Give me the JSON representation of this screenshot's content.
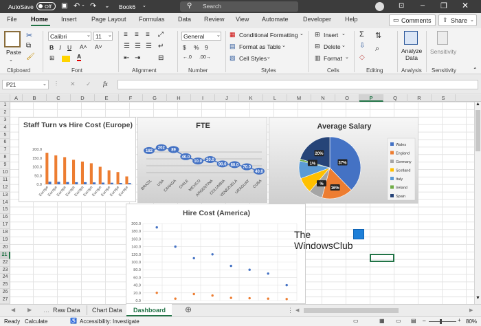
{
  "titlebar": {
    "autosave_label": "AutoSave",
    "autosave_state": "Off",
    "book_name": "Book6",
    "search_placeholder": "Search"
  },
  "tabs": [
    "File",
    "Home",
    "Insert",
    "Page Layout",
    "Formulas",
    "Data",
    "Review",
    "View",
    "Automate",
    "Developer",
    "Help"
  ],
  "active_tab": "Home",
  "comments_label": "Comments",
  "share_label": "Share",
  "ribbon": {
    "clipboard": {
      "paste": "Paste",
      "group": "Clipboard"
    },
    "font": {
      "name": "Calibri",
      "size": "11",
      "group": "Font"
    },
    "alignment": {
      "group": "Alignment"
    },
    "number": {
      "format": "General",
      "group": "Number"
    },
    "styles": {
      "conditional": "Conditional Formatting",
      "table": "Format as Table",
      "cell_styles": "Cell Styles",
      "group": "Styles"
    },
    "cells": {
      "insert": "Insert",
      "delete": "Delete",
      "format": "Format",
      "group": "Cells"
    },
    "editing": {
      "group": "Editing"
    },
    "analysis": {
      "analyze": "Analyze Data",
      "group": "Analysis"
    },
    "sensitivity": {
      "label": "Sensitivity",
      "group": "Sensitivity"
    }
  },
  "formula_bar": {
    "name_box": "P21",
    "fx": "fx",
    "value": ""
  },
  "columns": [
    "A",
    "B",
    "C",
    "D",
    "E",
    "F",
    "G",
    "H",
    "I",
    "J",
    "K",
    "L",
    "M",
    "N",
    "O",
    "P",
    "Q",
    "R",
    "S"
  ],
  "active_column": "P",
  "rows": [
    "1",
    "2",
    "3",
    "4",
    "5",
    "6",
    "7",
    "8",
    "9",
    "10",
    "11",
    "12",
    "13",
    "14",
    "15",
    "16",
    "17",
    "18",
    "19",
    "20",
    "21",
    "22",
    "23",
    "24",
    "25",
    "26",
    "27"
  ],
  "active_row": "21",
  "sheets": [
    "Raw Data",
    "Chart Data",
    "Dashboard"
  ],
  "active_sheet": "Dashboard",
  "status": {
    "ready": "Ready",
    "calculate": "Calculate",
    "accessibility": "Accessibility: Investigate",
    "zoom": "80%"
  },
  "watermark": {
    "line1": "The",
    "line2": "WindowsClub"
  },
  "colors": {
    "orange": "#ed7d31",
    "blue": "#4472c4",
    "gray": "#a5a5a5",
    "yellow": "#ffc000",
    "lightblue": "#5b9bd5",
    "green": "#70ad47",
    "navy": "#264478",
    "excel_green": "#217346"
  },
  "chart_data": [
    {
      "type": "bar",
      "title": "Staff Turn vs Hire Cost (Europe)",
      "ytick_labels": [
        "200.0",
        "150.0",
        "100.0",
        "50.0",
        "0.0"
      ],
      "ylim": [
        0,
        200
      ],
      "categories": [
        "Europe",
        "Europe",
        "Europe",
        "Europe",
        "Europe",
        "Europe",
        "Europe",
        "Europe",
        "Europe",
        "Europe"
      ],
      "series": [
        {
          "values": [
            180,
            165,
            155,
            140,
            130,
            120,
            100,
            80,
            70,
            45
          ]
        },
        {
          "values": [
            15,
            14,
            13,
            12,
            12,
            11,
            10,
            9,
            8,
            7
          ]
        }
      ]
    },
    {
      "type": "line",
      "title": "FTE",
      "categories": [
        "BRAZIL",
        "USA",
        "CANADA",
        "CHILE",
        "MEXICO",
        "ARGENTINA",
        "COLUMBIA",
        "VENEZUELA",
        "URAGUAY",
        "CUBA"
      ],
      "values": [
        182,
        202,
        189,
        140,
        110,
        120,
        90,
        85,
        70,
        40
      ],
      "labels": [
        "182",
        "202",
        "89",
        "40.0",
        "10.0",
        "20.0",
        "90.0",
        "80.0",
        "70.0",
        "40.0"
      ]
    },
    {
      "type": "pie",
      "title": "Average Salary",
      "legend": [
        "Wales",
        "England",
        "Germany",
        "Scotland",
        "Italy",
        "Ireland",
        "Spain"
      ],
      "values": [
        37,
        16,
        7,
        8,
        9,
        1,
        20
      ],
      "labels": [
        "37%",
        "16%",
        "%",
        "",
        "",
        "1%",
        "20%"
      ],
      "legend_position": "right"
    },
    {
      "type": "scatter",
      "title": "Hire Cost (America)",
      "ytick_labels": [
        "200.0",
        "180.0",
        "160.0",
        "140.0",
        "120.0",
        "100.0",
        "80.0",
        "60.0",
        "40.0",
        "20.0",
        "0.0"
      ],
      "ylim": [
        0,
        200
      ],
      "series": [
        {
          "values": [
            190,
            140,
            110,
            120,
            90,
            80,
            70,
            40
          ]
        },
        {
          "values": [
            20,
            5,
            17,
            13,
            7,
            6,
            5,
            4
          ]
        }
      ]
    }
  ]
}
